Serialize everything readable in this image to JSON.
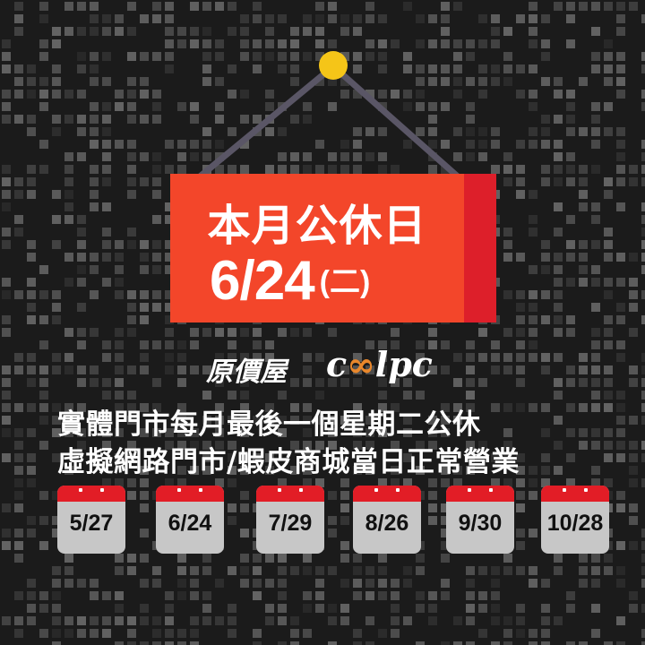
{
  "sign": {
    "title": "本月公休日",
    "date": "6/24",
    "weekday": "(二)",
    "main_color": "#f3462a",
    "side_color": "#dd1f2a"
  },
  "logo": {
    "chinese": "原價屋",
    "english_prefix": "c",
    "english_infinity": "∞",
    "english_suffix": "lpc"
  },
  "notice": {
    "line1": "實體門市每月最後一個星期二公休",
    "line2": "虛擬網路門市/蝦皮商城當日正常營業"
  },
  "holidays": [
    "5/27",
    "6/24",
    "7/29",
    "8/26",
    "9/30",
    "10/28"
  ],
  "colors": {
    "background": "#1b1b1b",
    "calendar_header": "#e21d26",
    "calendar_body": "#c7c7c7",
    "pin": "#f5c518",
    "logo_accent": "#e9872b"
  }
}
